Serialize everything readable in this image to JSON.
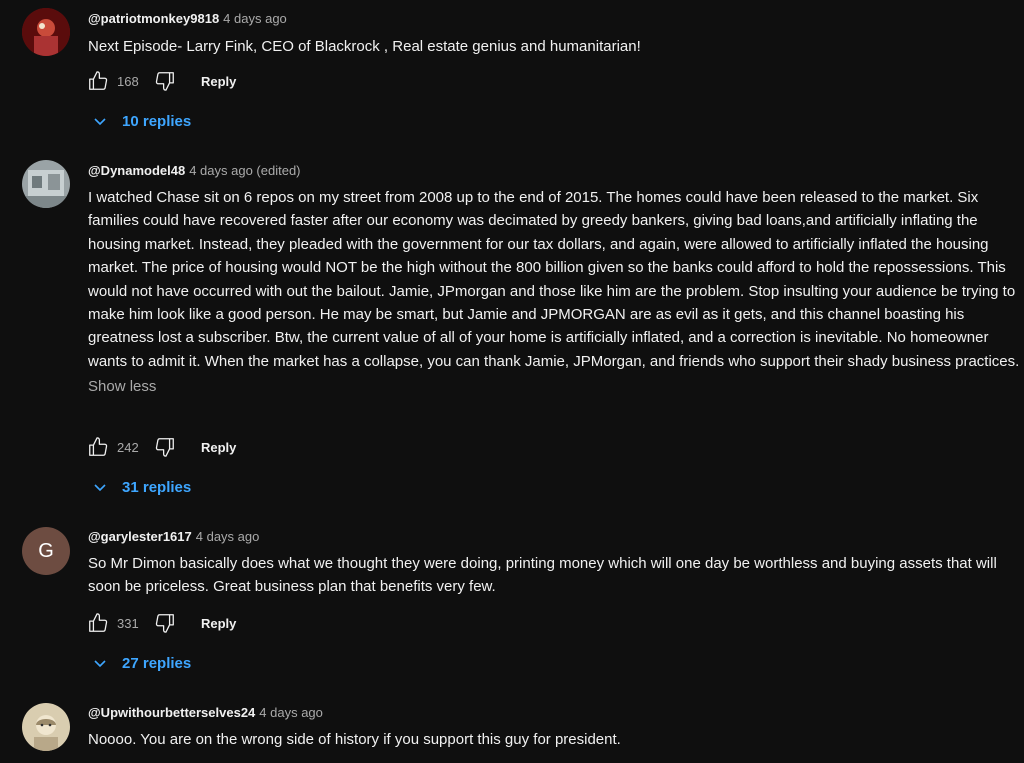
{
  "colors": {
    "background": "#0f0f0f",
    "text": "#f1f1f1",
    "secondary": "#aaaaaa",
    "link": "#3ea6ff",
    "avatar_g": "#6d4c41"
  },
  "reply_label": "Reply",
  "show_less": "Show less",
  "comments": [
    {
      "author": "@patriotmonkey9818",
      "time": "4 days ago",
      "text": "Next Episode- Larry Fink, CEO of Blackrock , Real estate genius and humanitarian!",
      "likes": "168",
      "replies": "10 replies",
      "avatar_icon": "photo-avatar-icon"
    },
    {
      "author": "@Dynamodel48",
      "time": "4 days ago (edited)",
      "text": "I watched Chase sit on 6 repos on my street from 2008 up to the end of 2015. The homes could have been released to the market. Six families could have recovered faster after our economy was decimated by greedy bankers, giving bad loans,and artificially inflating the housing market. Instead, they pleaded with the government for our tax dollars, and again, were allowed to artificially inflated the housing market. The price of housing would NOT be the high without the 800 billion given so the banks could afford to hold the repossessions. This would not have occurred with out the bailout. Jamie, JPmorgan and those like him are the problem. Stop insulting your audience be trying to make him look like a good person. He may be smart, but Jamie and JPMORGAN are as evil as it gets, and this channel boasting his greatness lost a subscriber. Btw, the current value of all of your home is artificially  inflated, and a correction is inevitable. No homeowner wants to admit it. When the market has a  collapse, you can thank Jamie, JPMorgan, and friends who support their shady business practices.",
      "likes": "242",
      "replies": "31 replies",
      "avatar_icon": "photo-avatar-icon"
    },
    {
      "author": "@garylester1617",
      "time": "4 days ago",
      "text": "So Mr Dimon basically does what we thought they were doing, printing money which will one day be worthless and buying assets that will soon be priceless. Great business plan that benefits very few.",
      "likes": "331",
      "replies": "27 replies",
      "avatar_letter": "G"
    },
    {
      "author": "@Upwithourbetterselves24",
      "time": "4 days ago",
      "text": "Noooo. You are on the wrong side of history if you support this guy for president.",
      "avatar_icon": "photo-avatar-icon"
    }
  ]
}
